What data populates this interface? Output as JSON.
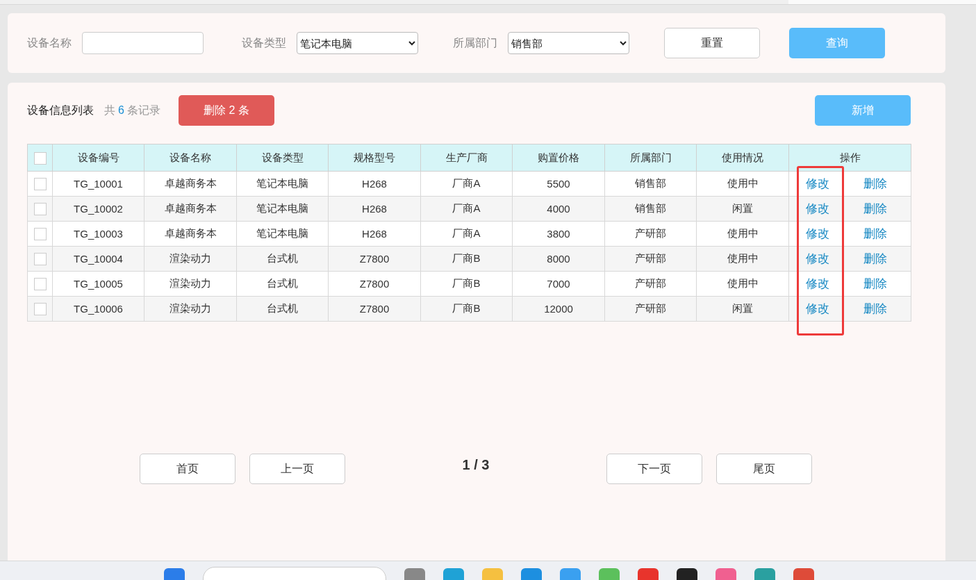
{
  "filters": [
    {
      "label": "设备名称",
      "kind": "text"
    },
    {
      "label": "设备类型",
      "kind": "select",
      "value": "笔记本电脑"
    },
    {
      "label": "所属部门",
      "kind": "select",
      "value": "销售部"
    }
  ],
  "filter_buttons": [
    {
      "label": "重置",
      "kind": "plain"
    },
    {
      "label": "查询",
      "kind": "primary"
    }
  ],
  "list": {
    "title": "设备信息列表",
    "count_prefix": "共",
    "count": "6",
    "count_suffix": "条记录",
    "bulk_delete": "删除 2 条",
    "add_button": "新增"
  },
  "table": {
    "header_checked": false,
    "columns": [
      "设备编号",
      "设备名称",
      "设备类型",
      "规格型号",
      "生产厂商",
      "购置价格",
      "所属部门",
      "使用情况",
      "操作"
    ],
    "rows": [
      {
        "checked": false,
        "cells": [
          "TG_10001",
          "卓越商务本",
          "笔记本电脑",
          "H268",
          "厂商A",
          "5500",
          "销售部",
          "使用中"
        ],
        "actions": [
          "修改",
          "删除"
        ]
      },
      {
        "checked": false,
        "cells": [
          "TG_10002",
          "卓越商务本",
          "笔记本电脑",
          "H268",
          "厂商A",
          "4000",
          "销售部",
          "闲置"
        ],
        "actions": [
          "修改",
          "删除"
        ]
      },
      {
        "checked": false,
        "cells": [
          "TG_10003",
          "卓越商务本",
          "笔记本电脑",
          "H268",
          "厂商A",
          "3800",
          "产研部",
          "使用中"
        ],
        "actions": [
          "修改",
          "删除"
        ]
      },
      {
        "checked": false,
        "cells": [
          "TG_10004",
          "渲染动力",
          "台式机",
          "Z7800",
          "厂商B",
          "8000",
          "产研部",
          "使用中"
        ],
        "actions": [
          "修改",
          "删除"
        ]
      },
      {
        "checked": false,
        "cells": [
          "TG_10005",
          "渲染动力",
          "台式机",
          "Z7800",
          "厂商B",
          "7000",
          "产研部",
          "使用中"
        ],
        "actions": [
          "修改",
          "删除"
        ]
      },
      {
        "checked": false,
        "cells": [
          "TG_10006",
          "渲染动力",
          "台式机",
          "Z7800",
          "厂商B",
          "12000",
          "产研部",
          "闲置"
        ],
        "actions": [
          "修改",
          "删除"
        ]
      }
    ],
    "highlight_edit_column": true
  },
  "pagination": {
    "first": "首页",
    "prev": "上一页",
    "page": "1 / 3",
    "next": "下一页",
    "last": "尾页"
  }
}
